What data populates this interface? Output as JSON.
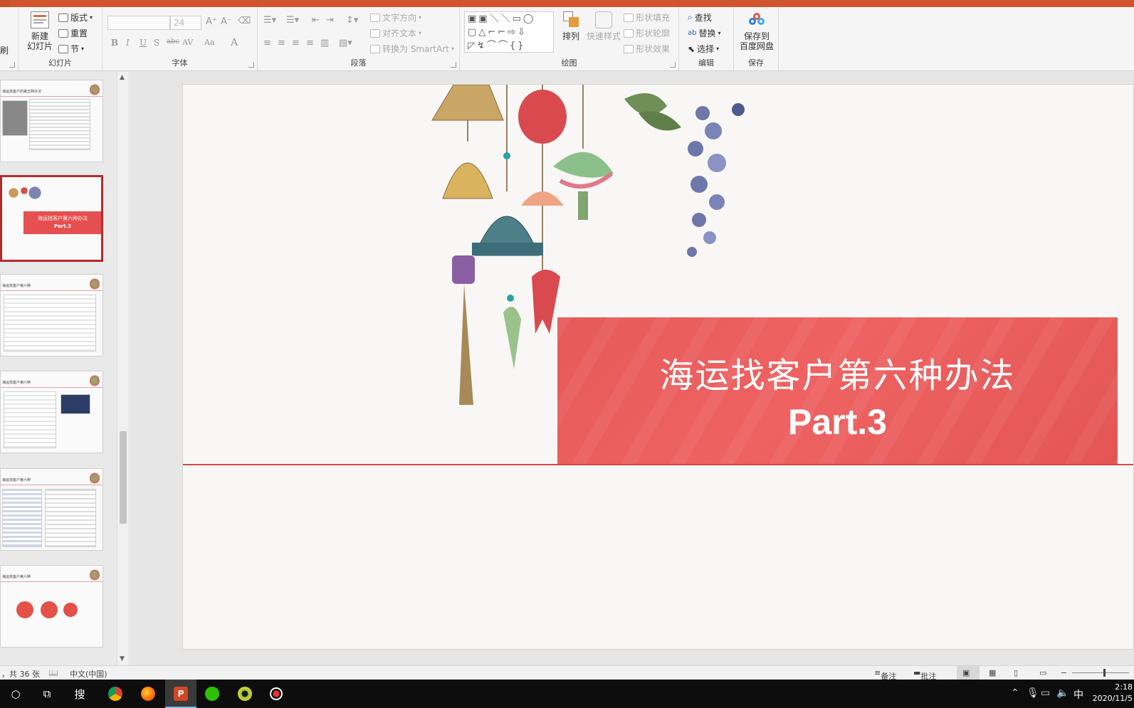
{
  "ribbon": {
    "slides_group": {
      "new_slide_line1": "新建",
      "new_slide_line2": "幻灯片",
      "layout": "版式",
      "reset": "重置",
      "section": "节",
      "label": "幻灯片"
    },
    "left_cut": "刷",
    "font_group": {
      "font_size": "24",
      "bold": "B",
      "italic": "I",
      "underline": "U",
      "shadow": "S",
      "strike": "abc",
      "spacing": "AV",
      "case": "Aa",
      "color": "A",
      "label": "字体"
    },
    "paragraph_group": {
      "text_direction": "文字方向",
      "align_text": "对齐文本",
      "convert_smartart": "转换为 SmartArt",
      "label": "段落"
    },
    "drawing_group": {
      "arrange": "排列",
      "quick_styles": "快速样式",
      "shape_fill": "形状填充",
      "shape_outline": "形状轮廓",
      "shape_effects": "形状效果",
      "label": "绘图"
    },
    "editing_group": {
      "find": "查找",
      "replace": "替换",
      "select": "选择",
      "label": "编辑"
    },
    "save_group": {
      "save_line1": "保存到",
      "save_line2": "百度网盘",
      "label": "保存"
    }
  },
  "thumbnails": [
    {
      "title": "海运找客户的第五种办法"
    },
    {
      "title": "海运找客户第六种办法",
      "subtitle": "Part.3",
      "selected": true
    },
    {
      "title": "海运找客户第六种"
    },
    {
      "title": "海运找客户第六种"
    },
    {
      "title": "海运找客户第六种"
    },
    {
      "title": "海运找客户第六种"
    }
  ],
  "slide": {
    "title": "海运找客户第六种办法",
    "subtitle": "Part.3"
  },
  "status": {
    "slide_count": "，共 36 张",
    "language": "中文(中国)",
    "notes": "备注",
    "comments": "批注"
  },
  "taskbar": {
    "time": "2:18",
    "date": "2020/11/5",
    "ime": "中"
  },
  "colors": {
    "accent": "#c9522a",
    "banner": "#e85b5b",
    "selected_border": "#b02d2d"
  }
}
